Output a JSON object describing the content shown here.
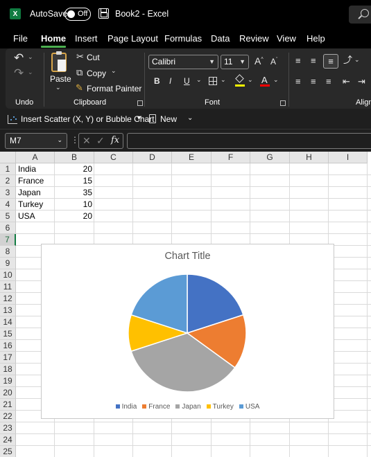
{
  "titlebar": {
    "autosave_label": "AutoSave",
    "autosave_state": "Off",
    "doc_title": "Book2  -  Excel"
  },
  "menu": {
    "tabs": [
      "File",
      "Home",
      "Insert",
      "Page Layout",
      "Formulas",
      "Data",
      "Review",
      "View",
      "Help"
    ],
    "active": "Home"
  },
  "ribbon": {
    "undo_group": "Undo",
    "clipboard_group": "Clipboard",
    "font_group": "Font",
    "align_group": "Align",
    "paste": "Paste",
    "cut": "Cut",
    "copy": "Copy",
    "format_painter": "Format Painter",
    "font_name": "Calibri",
    "font_size": "11"
  },
  "quick_toolbar": {
    "insert_chart": "Insert Scatter (X, Y) or Bubble Chart",
    "new": "New"
  },
  "formula_bar": {
    "name_box": "M7",
    "fx": "fx",
    "value": ""
  },
  "sheet": {
    "columns": [
      "A",
      "B",
      "C",
      "D",
      "E",
      "F",
      "G",
      "H",
      "I"
    ],
    "rows": [
      "1",
      "2",
      "3",
      "4",
      "5",
      "6",
      "7",
      "8",
      "9",
      "10",
      "11",
      "12",
      "13",
      "14",
      "15",
      "16",
      "17",
      "18",
      "19",
      "20",
      "21",
      "22",
      "23",
      "24",
      "25"
    ],
    "selected_row": "7",
    "cells": [
      {
        "a": "India",
        "b": "20"
      },
      {
        "a": "France",
        "b": "15"
      },
      {
        "a": "Japan",
        "b": "35"
      },
      {
        "a": "Turkey",
        "b": "10"
      },
      {
        "a": "USA",
        "b": "20"
      }
    ]
  },
  "chart_data": {
    "type": "pie",
    "title": "Chart Title",
    "categories": [
      "India",
      "France",
      "Japan",
      "Turkey",
      "USA"
    ],
    "values": [
      20,
      15,
      35,
      10,
      20
    ],
    "colors": [
      "#4472c4",
      "#ed7d31",
      "#a5a5a5",
      "#ffc000",
      "#5b9bd5"
    ],
    "legend": "bottom"
  }
}
